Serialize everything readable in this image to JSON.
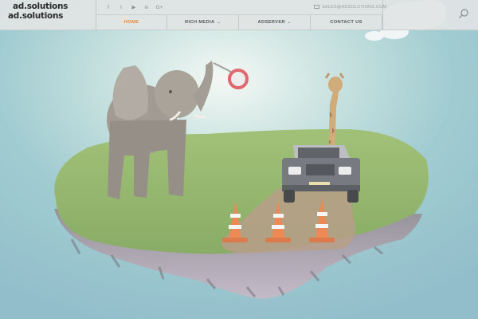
{
  "logo": {
    "line1": "ad.solutions",
    "line2": "ad.solutions"
  },
  "social": [
    {
      "icon": "facebook-icon",
      "glyph": "f"
    },
    {
      "icon": "twitter-icon",
      "glyph": "t"
    },
    {
      "icon": "youtube-icon",
      "glyph": "▶"
    },
    {
      "icon": "linkedin-icon",
      "glyph": "in"
    },
    {
      "icon": "google-plus-icon",
      "glyph": "G+"
    }
  ],
  "contact": {
    "email": "SALES@ADSOLUTIONS.COM"
  },
  "nav": {
    "items": [
      {
        "label": "HOME",
        "active": true,
        "dropdown": false
      },
      {
        "label": "RICH MEDIA",
        "active": false,
        "dropdown": true
      },
      {
        "label": "ADSERVER",
        "active": false,
        "dropdown": true
      },
      {
        "label": "CONTACT US",
        "active": false,
        "dropdown": false
      }
    ]
  },
  "colors": {
    "accent": "#e8873a",
    "header_bg": "#e1e4e4",
    "sky": "#8fc3c9"
  }
}
